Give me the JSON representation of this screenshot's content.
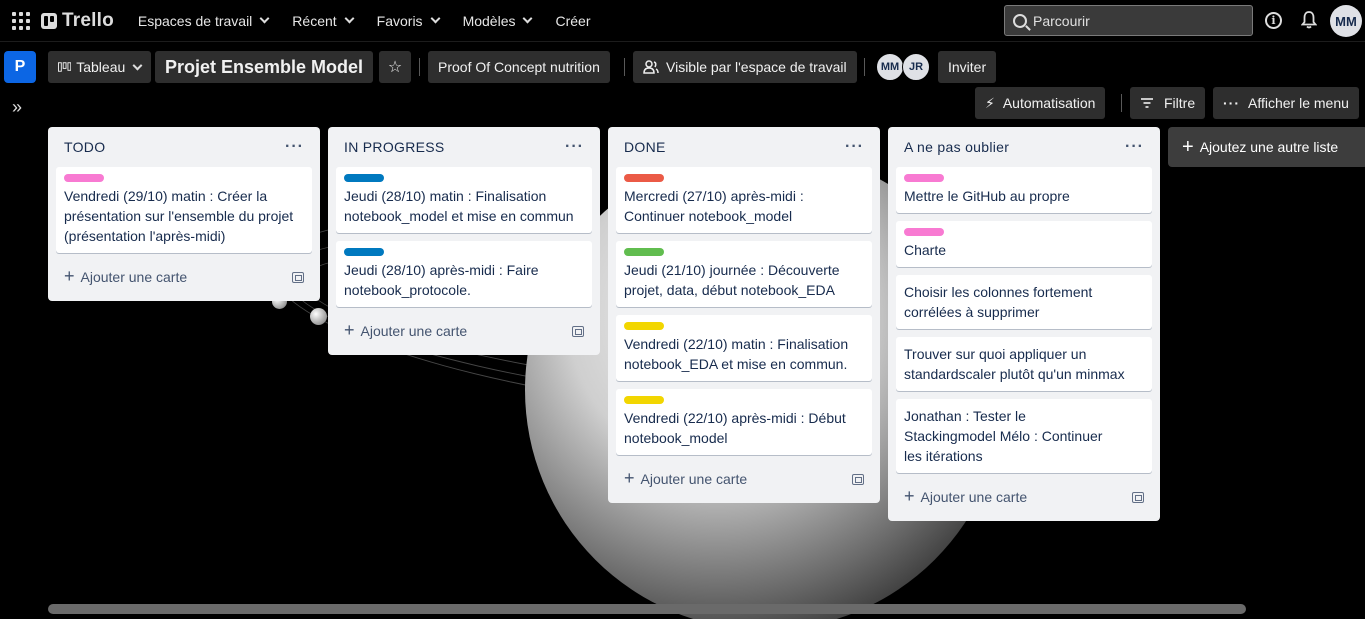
{
  "topbar": {
    "logo": "Trello",
    "nav": [
      {
        "label": "Espaces de travail",
        "dropdown": true
      },
      {
        "label": "Récent",
        "dropdown": true
      },
      {
        "label": "Favoris",
        "dropdown": true
      },
      {
        "label": "Modèles",
        "dropdown": true
      },
      {
        "label": "Créer",
        "dropdown": false
      }
    ],
    "search_placeholder": "Parcourir",
    "avatar": "MM"
  },
  "board": {
    "workspace_badge": "P",
    "view_label": "Tableau",
    "title": "Projet Ensemble Model",
    "workspace_name": "Proof Of Concept nutrition",
    "visibility": "Visible par l'espace de travail",
    "members": [
      "MM",
      "JR"
    ],
    "invite_label": "Inviter",
    "automation_label": "Automatisation",
    "filter_label": "Filtre",
    "menu_label": "Afficher le menu"
  },
  "lists": [
    {
      "title": "TODO",
      "cards": [
        {
          "label_color": "#f87ad2",
          "text": "Vendredi (29/10) matin : Créer la présentation sur l'ensemble du projet (présentation l'après-midi)"
        }
      ],
      "add_card": "Ajouter une carte"
    },
    {
      "title": "IN PROGRESS",
      "cards": [
        {
          "label_color": "#0079bf",
          "text": "Jeudi (28/10) matin : Finalisation notebook_model et mise en commun"
        },
        {
          "label_color": "#0079bf",
          "text": "Jeudi (28/10) après-midi : Faire notebook_protocole."
        }
      ],
      "add_card": "Ajouter une carte"
    },
    {
      "title": "DONE",
      "cards": [
        {
          "label_color": "#eb5a46",
          "text": "Mercredi (27/10) après-midi : Continuer notebook_model"
        },
        {
          "label_color": "#61bd4f",
          "text": "Jeudi (21/10) journée : Découverte projet, data, début notebook_EDA"
        },
        {
          "label_color": "#f2d600",
          "text": "Vendredi (22/10) matin : Finalisation notebook_EDA et mise en commun."
        },
        {
          "label_color": "#f2d600",
          "text": "Vendredi (22/10) après-midi : Début notebook_model"
        }
      ],
      "add_card": "Ajouter une carte"
    },
    {
      "title": "A ne pas oublier",
      "cards": [
        {
          "label_color": "#f87ad2",
          "text": "Mettre le GitHub au propre"
        },
        {
          "label_color": "#f87ad2",
          "text": "Charte"
        },
        {
          "label_color": null,
          "text": "Choisir les colonnes fortement corrélées à supprimer"
        },
        {
          "label_color": null,
          "text": "Trouver sur quoi appliquer un standardscaler plutôt qu'un minmax"
        },
        {
          "label_color": null,
          "text": "Jonathan : Tester le Stackingmodel Mélo : Continuer les itérations"
        }
      ],
      "add_card": "Ajouter une carte"
    }
  ],
  "add_list_label": "Ajoutez une autre liste"
}
